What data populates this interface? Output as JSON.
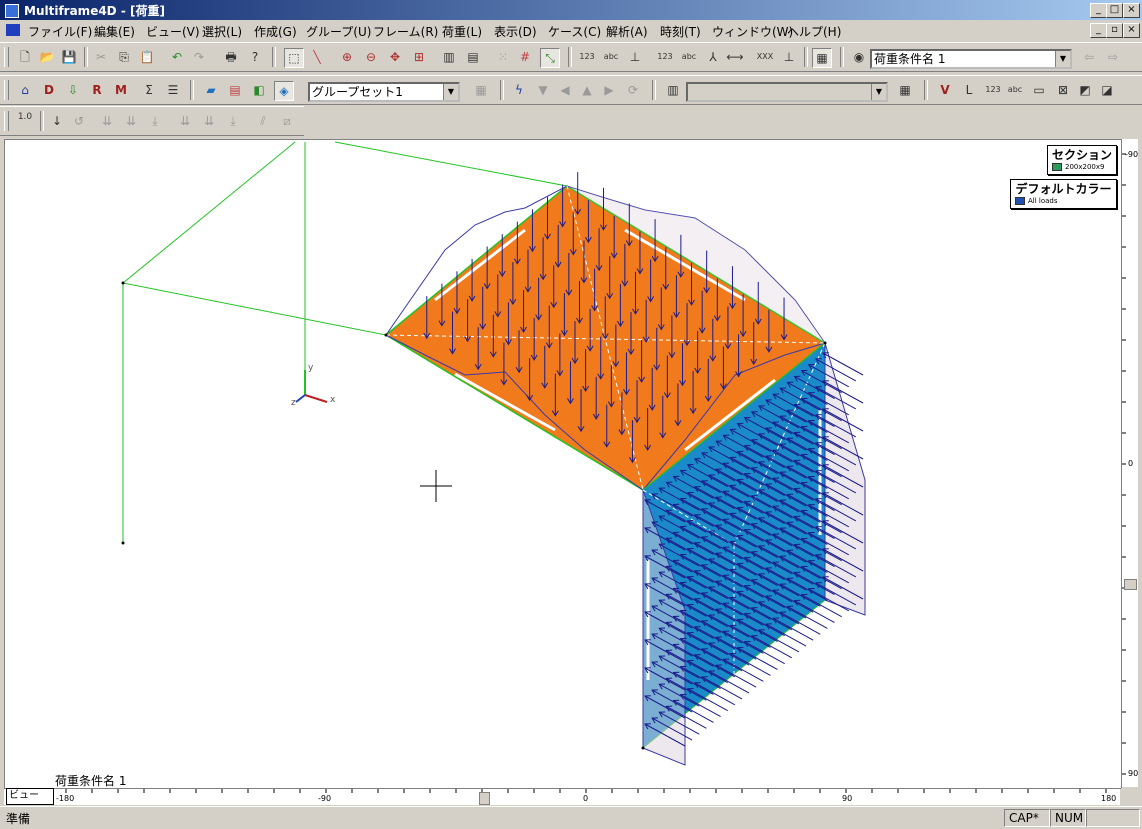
{
  "window": {
    "title": "Multiframe4D - [荷重]",
    "controls": [
      "_",
      "□",
      "×"
    ]
  },
  "menu": [
    "ファイル(F)",
    "編集(E)",
    "ビュー(V)",
    "選択(L)",
    "作成(G)",
    "グループ(U)",
    "フレーム(R)",
    "荷重(L)",
    "表示(D)",
    "ケース(C)",
    "解析(A)",
    "時刻(T)",
    "ウィンドウ(W)",
    "ヘルプ(H)"
  ],
  "toolbar1": {
    "icons": [
      "new-icon",
      "open-icon",
      "save-icon",
      "cut-icon",
      "copy-icon",
      "paste-icon",
      "undo-icon",
      "redo-icon",
      "print-icon",
      "help-icon",
      "select-box-icon",
      "draw-member-icon",
      "zoom-in-icon",
      "zoom-out-icon",
      "pan-icon",
      "zoom-fit-icon",
      "frame-grid-icon",
      "frame-grid2-icon",
      "snap-grid-icon",
      "grid-snap-icon",
      "axis-icon",
      "node-number-icon",
      "node-label-icon",
      "node-symbol-icon",
      "member-number-icon",
      "member-label-icon",
      "member-axis-icon",
      "member-length-icon",
      "section-label-icon",
      "member-orient-icon",
      "data-sheet-icon",
      "step-icon"
    ],
    "load_case_combo": "荷重条件名 1",
    "back_icon": "arrow-left-icon",
    "forward_icon": "arrow-right-icon"
  },
  "toolbar2": {
    "icons": [
      "home-icon",
      "d-icon",
      "down-icon",
      "r-icon",
      "m-icon",
      "sum-icon",
      "list-icon",
      "load-panel-icon",
      "load-table-icon",
      "load-split-icon",
      "load-view-icon"
    ],
    "group_combo": "グループセット1",
    "filter_combo": "",
    "right_icons": [
      "v-icon",
      "l-icon",
      "n123-icon",
      "abc-icon",
      "frame-icon",
      "cross-icon",
      "graph-icon",
      "graph2-icon"
    ]
  },
  "toolbar3": {
    "icons": [
      "load-scale-icon",
      "point-load-icon",
      "moment-icon",
      "dist-load-icon",
      "dist-load2-icon",
      "dist-load3-icon",
      "node-load-icon",
      "node-load2-icon",
      "node-load3-icon",
      "thermal-icon",
      "prestress-icon"
    ],
    "scale_label": "1.0"
  },
  "legend": {
    "section_title": "セクション",
    "section_item": "200x200x9",
    "color_title": "デフォルトカラー",
    "color_item": "All loads",
    "section_color": "#2a9d5c",
    "color_swatch": "#2050b0"
  },
  "canvas": {
    "load_case_label": "荷重条件名 1",
    "axis_labels": [
      "y",
      "z",
      "x"
    ]
  },
  "rulers": {
    "horizontal": [
      "-180",
      "-90",
      "0",
      "90",
      "180"
    ],
    "vertical": [
      "-90",
      "0",
      "90"
    ]
  },
  "view_tab": "ビュー",
  "status": {
    "message": "準備",
    "caps": "CAP*",
    "num": "NUM"
  },
  "colors": {
    "roof": "#f07a1c",
    "wall": "#1a8ac8",
    "load_arrows": "#1c1c8c",
    "frame_lines": "#22c322"
  }
}
